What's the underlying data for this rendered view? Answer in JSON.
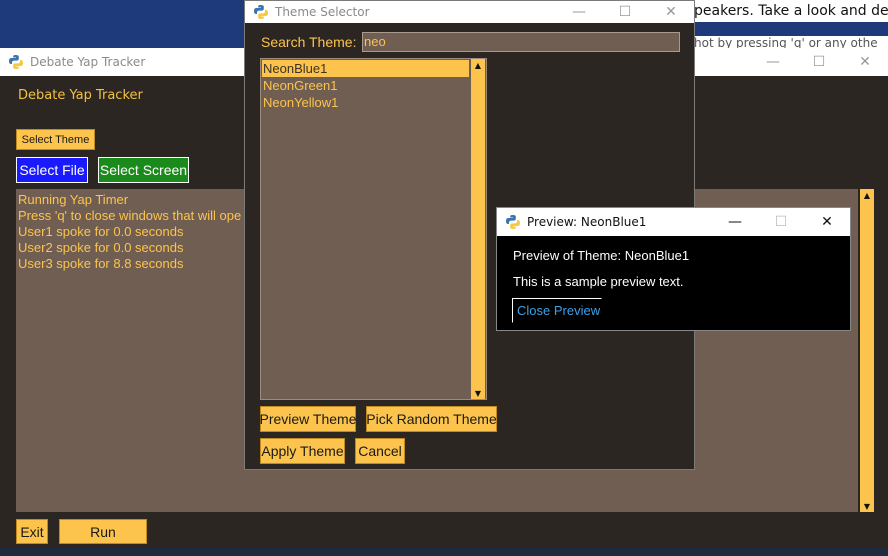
{
  "background": {
    "text_line1": "peakers. Take a look and deci",
    "text_line2": "hot by pressing 'q' or any othe"
  },
  "main_window": {
    "title": "Debate Yap Tracker",
    "heading": "Debate Yap Tracker",
    "select_theme_label": "Select Theme",
    "select_file_label": "Select File",
    "select_screen_label": "Select Screen",
    "log_lines": [
      "Running Yap Timer",
      "Press 'q' to close windows that will ope",
      "User1 spoke for 0.0 seconds",
      "User2 spoke for 0.0 seconds",
      "User3 spoke for 8.8 seconds"
    ],
    "exit_label": "Exit",
    "run_label": "Run"
  },
  "theme_selector": {
    "title": "Theme Selector",
    "search_label": "Search Theme:",
    "search_value": "neo",
    "themes": [
      "NeonBlue1",
      "NeonGreen1",
      "NeonYellow1"
    ],
    "selected_theme": "NeonBlue1",
    "preview_label": "Preview Theme",
    "random_label": "Pick Random Theme",
    "apply_label": "Apply Theme",
    "cancel_label": "Cancel"
  },
  "preview_window": {
    "title": "Preview: NeonBlue1",
    "line1": "Preview of Theme: NeonBlue1",
    "line2": "This is a sample preview text.",
    "close_label": "Close Preview"
  },
  "colors": {
    "window_bg": "#2b2622",
    "field_bg": "#705e52",
    "accent_yellow": "#fcc44c",
    "select_file_blue": "#1a1aff",
    "select_screen_green": "#1a8a1a",
    "preview_bg": "#000000",
    "preview_button_text": "#3aa0e8"
  },
  "icons": {
    "app_icon": "python-logo-icon",
    "minimize": "minimize-icon",
    "maximize": "maximize-icon",
    "close": "close-icon"
  }
}
